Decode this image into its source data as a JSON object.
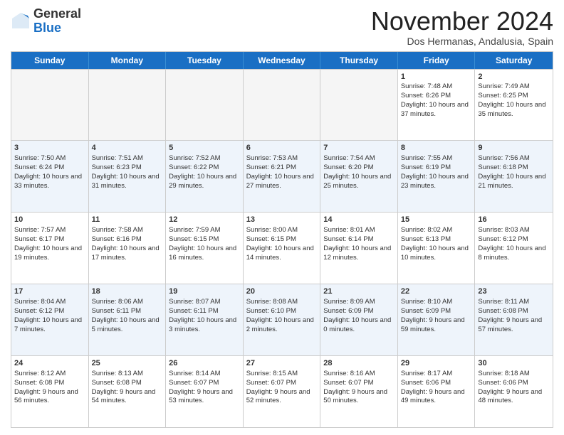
{
  "header": {
    "logo_general": "General",
    "logo_blue": "Blue",
    "month_title": "November 2024",
    "subtitle": "Dos Hermanas, Andalusia, Spain"
  },
  "days_of_week": [
    "Sunday",
    "Monday",
    "Tuesday",
    "Wednesday",
    "Thursday",
    "Friday",
    "Saturday"
  ],
  "weeks": [
    [
      {
        "day": "",
        "info": ""
      },
      {
        "day": "",
        "info": ""
      },
      {
        "day": "",
        "info": ""
      },
      {
        "day": "",
        "info": ""
      },
      {
        "day": "",
        "info": ""
      },
      {
        "day": "1",
        "info": "Sunrise: 7:48 AM\nSunset: 6:26 PM\nDaylight: 10 hours and 37 minutes."
      },
      {
        "day": "2",
        "info": "Sunrise: 7:49 AM\nSunset: 6:25 PM\nDaylight: 10 hours and 35 minutes."
      }
    ],
    [
      {
        "day": "3",
        "info": "Sunrise: 7:50 AM\nSunset: 6:24 PM\nDaylight: 10 hours and 33 minutes."
      },
      {
        "day": "4",
        "info": "Sunrise: 7:51 AM\nSunset: 6:23 PM\nDaylight: 10 hours and 31 minutes."
      },
      {
        "day": "5",
        "info": "Sunrise: 7:52 AM\nSunset: 6:22 PM\nDaylight: 10 hours and 29 minutes."
      },
      {
        "day": "6",
        "info": "Sunrise: 7:53 AM\nSunset: 6:21 PM\nDaylight: 10 hours and 27 minutes."
      },
      {
        "day": "7",
        "info": "Sunrise: 7:54 AM\nSunset: 6:20 PM\nDaylight: 10 hours and 25 minutes."
      },
      {
        "day": "8",
        "info": "Sunrise: 7:55 AM\nSunset: 6:19 PM\nDaylight: 10 hours and 23 minutes."
      },
      {
        "day": "9",
        "info": "Sunrise: 7:56 AM\nSunset: 6:18 PM\nDaylight: 10 hours and 21 minutes."
      }
    ],
    [
      {
        "day": "10",
        "info": "Sunrise: 7:57 AM\nSunset: 6:17 PM\nDaylight: 10 hours and 19 minutes."
      },
      {
        "day": "11",
        "info": "Sunrise: 7:58 AM\nSunset: 6:16 PM\nDaylight: 10 hours and 17 minutes."
      },
      {
        "day": "12",
        "info": "Sunrise: 7:59 AM\nSunset: 6:15 PM\nDaylight: 10 hours and 16 minutes."
      },
      {
        "day": "13",
        "info": "Sunrise: 8:00 AM\nSunset: 6:15 PM\nDaylight: 10 hours and 14 minutes."
      },
      {
        "day": "14",
        "info": "Sunrise: 8:01 AM\nSunset: 6:14 PM\nDaylight: 10 hours and 12 minutes."
      },
      {
        "day": "15",
        "info": "Sunrise: 8:02 AM\nSunset: 6:13 PM\nDaylight: 10 hours and 10 minutes."
      },
      {
        "day": "16",
        "info": "Sunrise: 8:03 AM\nSunset: 6:12 PM\nDaylight: 10 hours and 8 minutes."
      }
    ],
    [
      {
        "day": "17",
        "info": "Sunrise: 8:04 AM\nSunset: 6:12 PM\nDaylight: 10 hours and 7 minutes."
      },
      {
        "day": "18",
        "info": "Sunrise: 8:06 AM\nSunset: 6:11 PM\nDaylight: 10 hours and 5 minutes."
      },
      {
        "day": "19",
        "info": "Sunrise: 8:07 AM\nSunset: 6:11 PM\nDaylight: 10 hours and 3 minutes."
      },
      {
        "day": "20",
        "info": "Sunrise: 8:08 AM\nSunset: 6:10 PM\nDaylight: 10 hours and 2 minutes."
      },
      {
        "day": "21",
        "info": "Sunrise: 8:09 AM\nSunset: 6:09 PM\nDaylight: 10 hours and 0 minutes."
      },
      {
        "day": "22",
        "info": "Sunrise: 8:10 AM\nSunset: 6:09 PM\nDaylight: 9 hours and 59 minutes."
      },
      {
        "day": "23",
        "info": "Sunrise: 8:11 AM\nSunset: 6:08 PM\nDaylight: 9 hours and 57 minutes."
      }
    ],
    [
      {
        "day": "24",
        "info": "Sunrise: 8:12 AM\nSunset: 6:08 PM\nDaylight: 9 hours and 56 minutes."
      },
      {
        "day": "25",
        "info": "Sunrise: 8:13 AM\nSunset: 6:08 PM\nDaylight: 9 hours and 54 minutes."
      },
      {
        "day": "26",
        "info": "Sunrise: 8:14 AM\nSunset: 6:07 PM\nDaylight: 9 hours and 53 minutes."
      },
      {
        "day": "27",
        "info": "Sunrise: 8:15 AM\nSunset: 6:07 PM\nDaylight: 9 hours and 52 minutes."
      },
      {
        "day": "28",
        "info": "Sunrise: 8:16 AM\nSunset: 6:07 PM\nDaylight: 9 hours and 50 minutes."
      },
      {
        "day": "29",
        "info": "Sunrise: 8:17 AM\nSunset: 6:06 PM\nDaylight: 9 hours and 49 minutes."
      },
      {
        "day": "30",
        "info": "Sunrise: 8:18 AM\nSunset: 6:06 PM\nDaylight: 9 hours and 48 minutes."
      }
    ]
  ]
}
